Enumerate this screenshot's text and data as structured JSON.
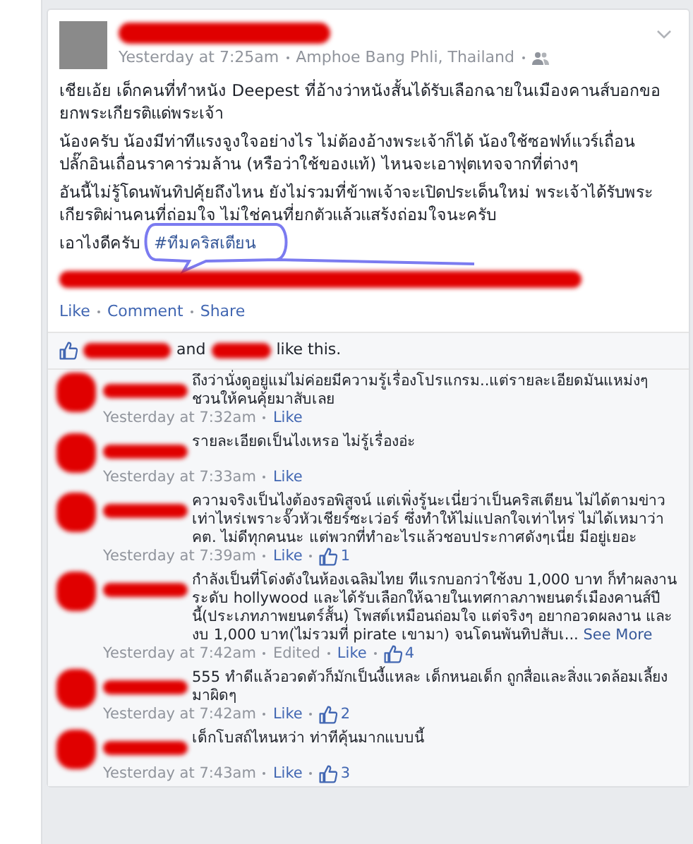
{
  "post": {
    "time": "Yesterday at 7:25am",
    "location": "Amphoe Bang Phli, Thailand",
    "paragraphs": [
      "เชียเอ้ย เด็กคนที่ทำหนัง Deepest ที่อ้างว่าหนังสั้นได้รับเลือกฉายในเมืองคานส์บอกขอยกพระเกียรติแด่พระเจ้า",
      "น้องครับ น้องมีท่าทีแรงจูงใจอย่างไร ไม่ต้องอ้างพระเจ้าก็ได้ น้องใช้ซอฟท์แวร์เถื่อน ปลั๊กอินเถื่อนราคาร่วมล้าน (หรือว่าใช้ของแท้) ไหนจะเอาฟุตเทจจากที่ต่างๆ",
      "อันนี้ไม่รู้โดนพันทิปคุ้ยถึงไหน ยังไม่รวมที่ข้าพเจ้าจะเปิดประเด็นใหม่ พระเจ้าได้รับพระเกียรติผ่านคนที่ถ่อมใจ ไม่ใช่คนที่ยกตัวแล้วแสร้งถ่อมใจนะครับ"
    ],
    "closing": "เอาไงดีครับ",
    "hashtag": "#ทีมคริสเตียน",
    "actions": [
      "Like",
      "Comment",
      "Share"
    ]
  },
  "likes": {
    "joiner": "and",
    "suffix": "like this."
  },
  "comments": [
    {
      "text": "ถึงว่านั่งดูอยู่แม่ไม่ค่อยมีความรู้เรื่องโปรแกรม..แต่รายละเอียดมันแหม่งๆ ชวนให้คนคุ้ยมาสับเลย",
      "time": "Yesterday at 7:32am",
      "like": "Like"
    },
    {
      "text": "รายละเอียดเป็นไงเหรอ ไม่รู้เรื่องอ่ะ",
      "time": "Yesterday at 7:33am",
      "like": "Like"
    },
    {
      "text": "ความจริงเป็นไงต้องรอพิสูจน์ แต่เพิ่งรู้นะเนี่ยว่าเป็นคริสเตียน ไม่ได้ตามข่าวเท่าไหร่เพราะจั๊วหัวเชียร์ซะเว่อร์ ซึ่งทำให้ไม่แปลกใจเท่าไหร่ ไม่ได้เหมาว่า คต. ไม่ดีทุกคนนะ แต่พวกที่ทำอะไรแล้วชอบประกาศดังๆเนี่ย มีอยู่เยอะ",
      "time": "Yesterday at 7:39am",
      "like": "Like",
      "like_count": "1"
    },
    {
      "text": "กำลังเป็นที่โด่งดังในห้องเฉลิมไทย ทีแรกบอกว่าใช้งบ 1,000 บาท ก็ทำผลงานระดับ hollywood และได้รับเลือกให้ฉายในเทศกาลภาพยนตร์เมืองคานส์ปีนี้(ประเภทภาพยนตร์สั้น) โพสต์เหมือนถ่อมใจ แต่จริงๆ อยากอวดผลงาน และงบ 1,000 บาท(ไม่รวมที่ pirate เขามา) จนโดนพันทิปสับเ...",
      "see_more": "See More",
      "time": "Yesterday at 7:42am",
      "edited": "Edited",
      "like": "Like",
      "like_count": "4"
    },
    {
      "text": "555 ทำดีแล้วอวดตัวก็มักเป็นงี้แหละ เด็กหนอเด็ก ถูกสื่อและสิ่งแวดล้อมเลี้ยงมาผิดๆ",
      "time": "Yesterday at 7:42am",
      "like": "Like",
      "like_count": "2"
    },
    {
      "text": "เด็กโบสถ์ไหนหว่า ท่าทีคุ้นมากแบบนี้",
      "time": "Yesterday at 7:43am",
      "like": "Like",
      "like_count": "3"
    }
  ]
}
